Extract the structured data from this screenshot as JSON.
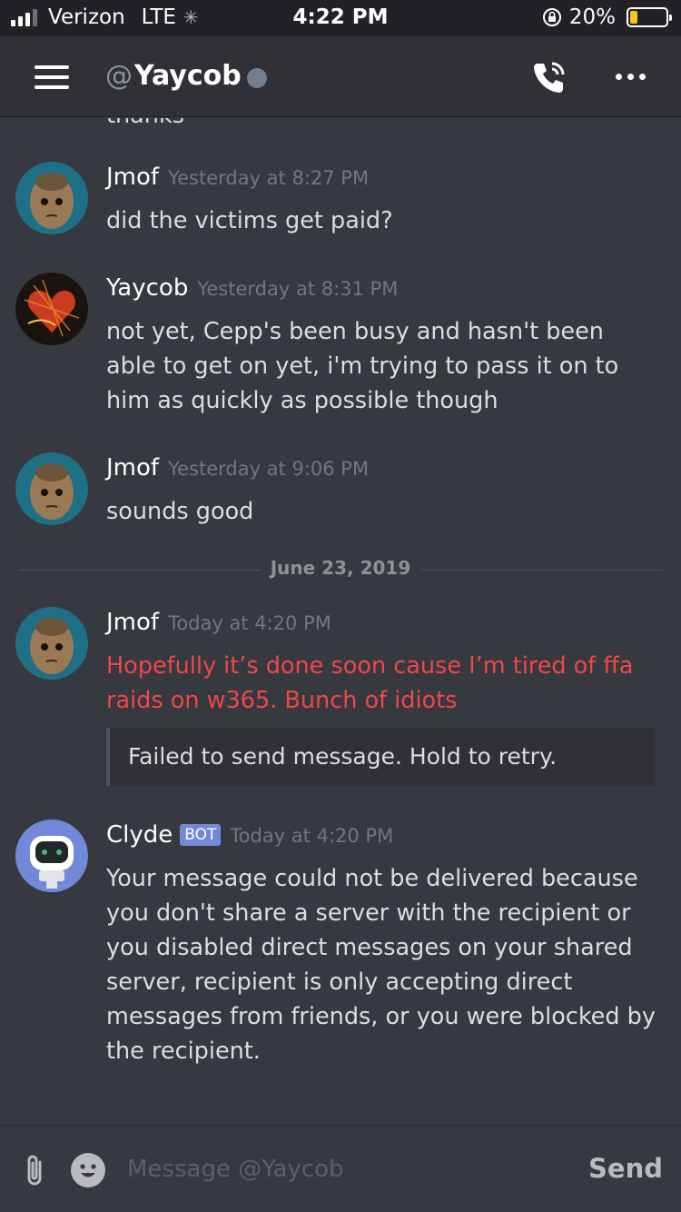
{
  "status_bar": {
    "carrier": "Verizon",
    "network": "LTE",
    "time": "4:22 PM",
    "battery": "20%",
    "battery_level": 0.2
  },
  "header": {
    "at_sign": "@",
    "channel_name": "Yaycob",
    "icons": [
      "menu-icon",
      "phone-call-icon",
      "more-icon"
    ]
  },
  "messages": [
    {
      "author": "Jmof",
      "timestamp": "Yesterday at 8:27 PM",
      "text": "did the victims get paid?"
    },
    {
      "author": "Yaycob",
      "timestamp": "Yesterday at 8:31 PM",
      "text": "not yet, Cepp's been busy and hasn't been able to get on yet, i'm trying to pass it on to him as quickly as possible though"
    },
    {
      "author": "Jmof",
      "timestamp": "Yesterday at 9:06 PM",
      "text": "sounds good"
    },
    {
      "author": "Jmof",
      "timestamp": "Today at 4:20 PM",
      "text": "Hopefully it’s done soon cause I’m tired of ffa raids on w365. Bunch of idiots",
      "failed_notice": "Failed to send message. Hold to retry."
    },
    {
      "author": "Clyde",
      "badge": "BOT",
      "timestamp": "Today at 4:20 PM",
      "text": "Your message could not be delivered because you don't share a server with the recipient or you disabled direct messages on your shared server, recipient is only accepting direct messages from friends, or you were blocked by the recipient."
    }
  ],
  "date_divider": "June 23, 2019",
  "composer": {
    "placeholder": "Message @Yaycob",
    "send_label": "Send"
  },
  "colors": {
    "background": "#36393f",
    "header": "#2f3136",
    "failed_text": "#f04747",
    "bot_badge": "#7289da",
    "battery": "#f5c518"
  }
}
